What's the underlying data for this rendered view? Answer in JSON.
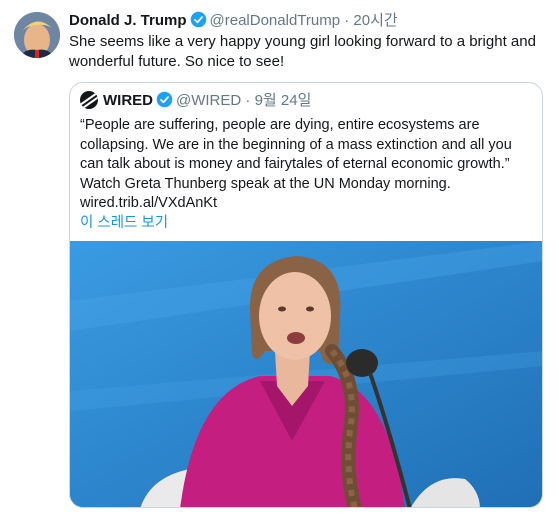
{
  "tweet": {
    "display_name": "Donald J. Trump",
    "handle": "@realDonaldTrump",
    "separator": "·",
    "time": "20시간",
    "text": "She seems like a very happy young girl looking forward to a bright and wonderful future. So nice to see!"
  },
  "quoted_tweet": {
    "display_name": "WIRED",
    "handle": "@WIRED",
    "separator": "·",
    "date": "9월 24일",
    "text": "“People are suffering, people are dying, entire ecosystems are collapsing. We are in the beginning of a mass extinction and all you can talk about is money and fairytales of eternal economic growth.” Watch Greta Thunberg speak at the UN Monday morning.",
    "link": "wired.trib.al/VXdAnKt",
    "show_thread": "이 스레드 보기"
  },
  "colors": {
    "verified_badge": "#1da1f2",
    "link_blue": "#1b95e0",
    "secondary_text": "#657786",
    "photo_background": "#2f8fd6",
    "shirt_magenta": "#c41f80"
  },
  "icons": {
    "verified": "verified-badge-icon",
    "wired_logo": "wired-logo-icon"
  }
}
